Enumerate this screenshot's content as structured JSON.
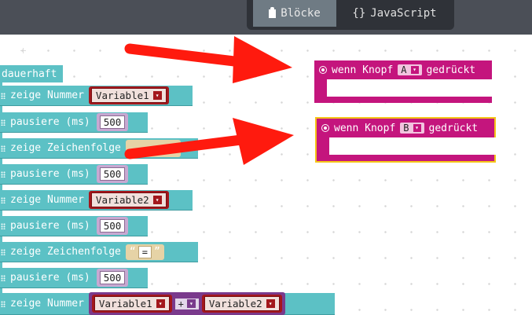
{
  "toolbar": {
    "tab_blocks": "Blöcke",
    "tab_javascript": "JavaScript",
    "tab_js_icon_text": "{}"
  },
  "blocks": {
    "hat_label": "dauerhaft",
    "row1": {
      "label": "zeige Nummer",
      "var": "Variable1"
    },
    "row2": {
      "label": "pausiere (ms)",
      "value": "500"
    },
    "row3": {
      "label": "zeige Zeichenfolge"
    },
    "row4": {
      "label": "pausiere (ms)",
      "value": "500"
    },
    "row5": {
      "label": "zeige Nummer",
      "var": "Variable2"
    },
    "row6": {
      "label": "pausiere (ms)",
      "value": "500"
    },
    "row7": {
      "label": "zeige Zeichenfolge",
      "quote_open": "“",
      "string": "=",
      "quote_close": "”"
    },
    "row8": {
      "label": "pausiere (ms)",
      "value": "500"
    },
    "row9": {
      "label": "zeige Nummer",
      "var_a": "Variable1",
      "op": "+",
      "var_b": "Variable2"
    }
  },
  "events": {
    "event_a": {
      "prefix": "wenn Knopf",
      "key": "A",
      "suffix": "gedrückt"
    },
    "event_b": {
      "prefix": "wenn Knopf",
      "key": "B",
      "suffix": "gedrückt"
    }
  },
  "colors": {
    "topbar": "#4b4f57",
    "basic_blocks": "#5cc1c5",
    "variables": "#a3171c",
    "input_events": "#c4157d",
    "arrows": "#ff1a0e",
    "highlight": "#f5c518"
  }
}
